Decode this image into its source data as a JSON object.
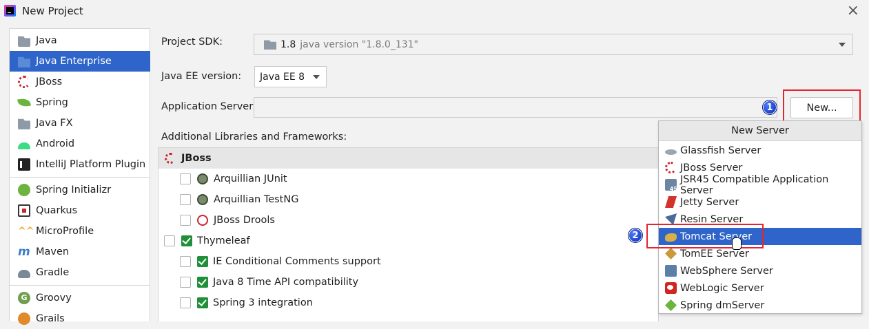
{
  "window": {
    "title": "New Project"
  },
  "sidebar": {
    "items": [
      {
        "label": "Java",
        "icon": "folder-icon"
      },
      {
        "label": "Java Enterprise",
        "icon": "java-enterprise-icon",
        "selected": true
      },
      {
        "label": "JBoss",
        "icon": "jboss-icon"
      },
      {
        "label": "Spring",
        "icon": "spring-leaf-icon"
      },
      {
        "label": "Java FX",
        "icon": "folder-icon"
      },
      {
        "label": "Android",
        "icon": "android-icon"
      },
      {
        "label": "IntelliJ Platform Plugin",
        "icon": "intellij-icon"
      },
      {
        "label": "Spring Initializr",
        "icon": "spring-initializr-icon"
      },
      {
        "label": "Quarkus",
        "icon": "quarkus-icon"
      },
      {
        "label": "MicroProfile",
        "icon": "microprofile-icon"
      },
      {
        "label": "Maven",
        "icon": "maven-icon"
      },
      {
        "label": "Gradle",
        "icon": "gradle-icon"
      },
      {
        "label": "Groovy",
        "icon": "groovy-icon"
      },
      {
        "label": "Grails",
        "icon": "grails-icon"
      }
    ]
  },
  "form": {
    "sdk_label": "Project SDK:",
    "sdk_version": "1.8",
    "sdk_desc": "java version \"1.8.0_131\"",
    "ee_label": "Java EE version:",
    "ee_value": "Java EE 8",
    "app_server_label": "Application Server:",
    "app_server_value": "",
    "new_button": "New...",
    "libs_label": "Additional Libraries and Frameworks:"
  },
  "libraries": {
    "header": "JBoss",
    "rows": [
      {
        "label": "Arquillian JUnit",
        "checked": false
      },
      {
        "label": "Arquillian TestNG",
        "checked": false
      },
      {
        "label": "JBoss Drools",
        "checked": false
      },
      {
        "label": "Thymeleaf",
        "checked": false
      },
      {
        "label": "IE Conditional Comments support",
        "checked": false
      },
      {
        "label": "Java 8 Time API compatibility",
        "checked": false
      },
      {
        "label": "Spring 3 integration",
        "checked": false
      }
    ]
  },
  "popup": {
    "title": "New Server",
    "items": [
      {
        "label": "Glassfish Server"
      },
      {
        "label": "JBoss Server"
      },
      {
        "label": "JSR45 Compatible Application Server"
      },
      {
        "label": "Jetty Server"
      },
      {
        "label": "Resin Server"
      },
      {
        "label": "Tomcat Server",
        "selected": true
      },
      {
        "label": "TomEE Server"
      },
      {
        "label": "WebSphere Server"
      },
      {
        "label": "WebLogic Server"
      },
      {
        "label": "Spring dmServer"
      }
    ]
  },
  "annotations": {
    "badge1": "1",
    "badge2": "2"
  },
  "colors": {
    "selection": "#2f65ca",
    "annotation_red": "#e5242e",
    "check_green": "#1f8f3a"
  }
}
